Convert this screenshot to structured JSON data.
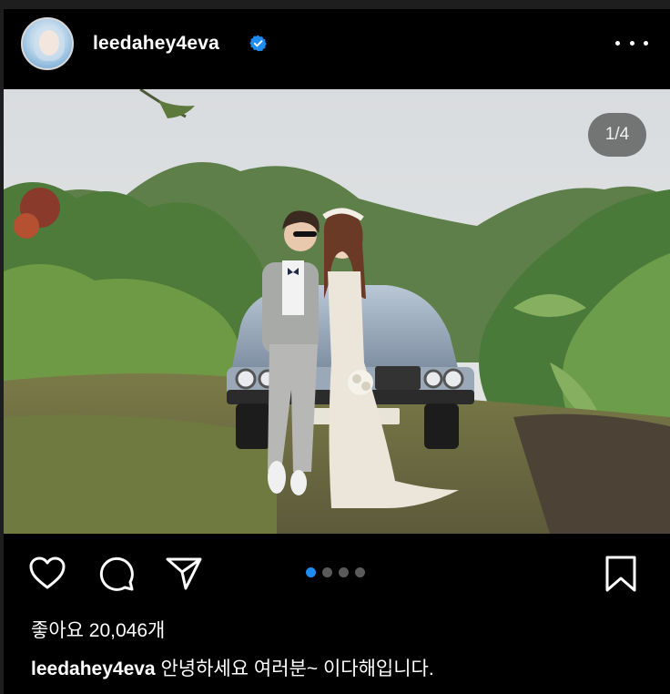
{
  "post": {
    "username": "leedahey4eva",
    "verified": true,
    "more_icon": "more-horizontal-icon",
    "image_counter": "1/4",
    "carousel": {
      "total": 4,
      "active_index": 0
    },
    "likes_text": "좋아요 20,046개",
    "caption_username": "leedahey4eva",
    "caption_text": "안녕하세요 여러분~ 이다해입니다."
  },
  "actions": {
    "like_icon": "heart-icon",
    "comment_icon": "comment-icon",
    "share_icon": "send-icon",
    "save_icon": "bookmark-icon"
  },
  "colors": {
    "background": "#000000",
    "accent": "#1E8CF0",
    "verified_badge": "#1E8CF0",
    "inactive_dot": "#5A5A5A"
  }
}
